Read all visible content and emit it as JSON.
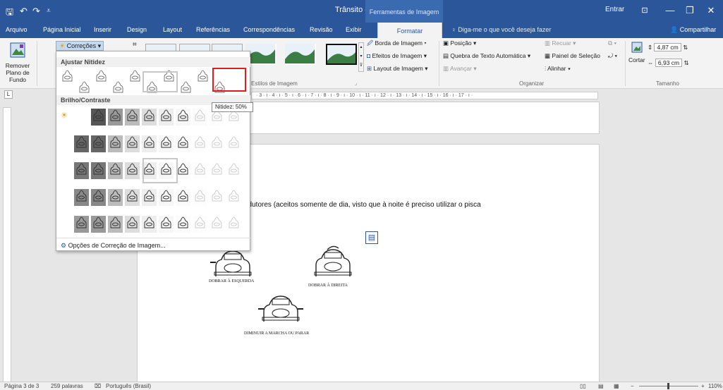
{
  "window": {
    "title": "Trânsito - Word",
    "context_title": "Ferramentas de Imagem",
    "signin": "Entrar",
    "qa_save": "🖫",
    "qa_undo": "↶",
    "qa_redo": "↷",
    "qa_more": "⩡",
    "ribbon_display": "⊡",
    "minimize": "—",
    "restore": "❐",
    "close": "✕"
  },
  "tabs": [
    {
      "label": "Arquivo"
    },
    {
      "label": "Página Inicial"
    },
    {
      "label": "Inserir"
    },
    {
      "label": "Design"
    },
    {
      "label": "Layout"
    },
    {
      "label": "Referências"
    },
    {
      "label": "Correspondências"
    },
    {
      "label": "Revisão"
    },
    {
      "label": "Exibir"
    }
  ],
  "active_tab": "Formatar",
  "tell_me": "Diga-me o que você deseja fazer",
  "share": "Compartilhar",
  "ribbon": {
    "remove_bg": "Remover Plano de Fundo",
    "corrections": "Correções",
    "image_styles_label": "Estilos de Imagem",
    "border": "Borda de Imagem",
    "effects": "Efeitos de Imagem",
    "layout": "Layout de Imagem",
    "position": "Posição",
    "wrap": "Quebra de Texto Automática",
    "forward": "Avançar",
    "backward": "Recuar",
    "selection_pane": "Painel de Seleção",
    "align": "Alinhar",
    "arrange_label": "Organizar",
    "crop": "Cortar",
    "height": "4,87 cm",
    "width": "6,93 cm",
    "size_label": "Tamanho"
  },
  "dropdown": {
    "sharpness_header": "Ajustar Nitidez",
    "brightness_header": "Brilho/Contraste",
    "tooltip": "Nitidez: 50%",
    "options": "Opções de Correção de Imagem..."
  },
  "ruler": {
    "ticks": "· 3 · ı · 4 · ı · 5 · ı · 6 · ı · 7 · ı · 8 · ı · 9 · ı · 10 · ı · 11 · ı · 12 · ı · 13 · ı · 14 · ı · 15 · ı · 16 · ı · 17 · ı ·"
  },
  "document": {
    "text": "ndutores (aceitos somente de dia, visto que à noite é preciso utilizar o pisca",
    "caption_left": "DOBRAR À ESQUERDA",
    "caption_right": "DOBRAR À DIREITA",
    "caption_bottom": "DIMINUIR A MARCHA OU PARAR"
  },
  "status": {
    "page": "Página 3 de 3",
    "words": "259 palavras",
    "language": "Português (Brasil)",
    "zoom": "110%"
  }
}
